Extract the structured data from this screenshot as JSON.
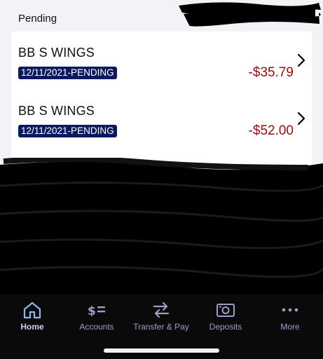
{
  "pending": {
    "header": "Pending",
    "transactions": [
      {
        "merchant": "BB S WINGS",
        "status": "12/11/2021-PENDING",
        "amount": "-$35.79"
      },
      {
        "merchant": "BB S WINGS",
        "status": "12/11/2021-PENDING",
        "amount": "-$52.00"
      }
    ]
  },
  "tabbar": {
    "items": [
      {
        "label": "Home",
        "icon": "home-icon"
      },
      {
        "label": "Accounts",
        "icon": "accounts-icon"
      },
      {
        "label": "Transfer & Pay",
        "icon": "transfer-icon"
      },
      {
        "label": "Deposits",
        "icon": "camera-icon"
      },
      {
        "label": "More",
        "icon": "more-icon"
      }
    ]
  },
  "colors": {
    "badge": "#0b1a5e",
    "amount": "#8b1111",
    "tab_active": "#c6d2f0",
    "tab_inactive": "#9aa0c8"
  }
}
